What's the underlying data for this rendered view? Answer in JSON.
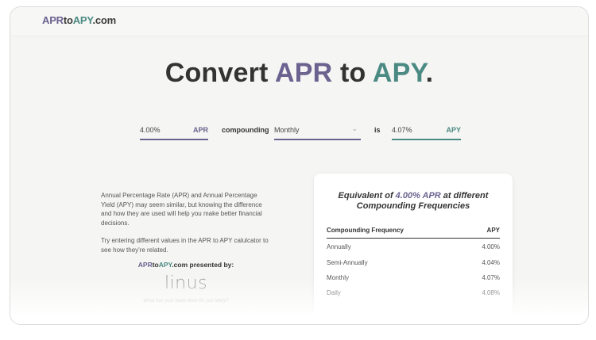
{
  "logo": {
    "apr": "APR",
    "to": "to",
    "apy": "APY",
    "suffix": ".com"
  },
  "hero": {
    "convert": "Convert",
    "apr": "APR",
    "to": "to",
    "apy": "APY",
    "dot": "."
  },
  "calculator": {
    "apr_value": "4.00%",
    "apr_tag": "APR",
    "compounding_label": "compounding",
    "frequency_selected": "Monthly",
    "is_label": "is",
    "apy_value": "4.07%",
    "apy_tag": "APY"
  },
  "intro": {
    "paragraph1": "Annual Percentage Rate (APR) and Annual Percentage Yield (APY) may seem similar, but knowing the difference and how they are used will help you make better financial decisions.",
    "paragraph2": "Try entering different values in the APR to APY calulcator to see how they're related."
  },
  "presented": {
    "apr": "APR",
    "to": "to",
    "apy": "APY",
    "suffix": ".com presented by:"
  },
  "sponsor": {
    "name": "linus",
    "tagline": "What has your bank done for you lately?"
  },
  "table_card": {
    "title_prefix": "Equivalent of ",
    "title_value": "4.00% APR",
    "title_suffix": " at different",
    "title_line2": "Compounding Frequencies",
    "col_frequency": "Compounding Frequency",
    "col_apy": "APY",
    "rows": [
      {
        "frequency": "Annually",
        "apy": "4.00%"
      },
      {
        "frequency": "Semi-Annually",
        "apy": "4.04%"
      },
      {
        "frequency": "Monthly",
        "apy": "4.07%"
      },
      {
        "frequency": "Daily",
        "apy": "4.08%"
      }
    ]
  },
  "colors": {
    "apr": "#6b628f",
    "apy": "#4a8a83",
    "text": "#333333"
  },
  "icons": {
    "dropdown": "chevron-down-icon"
  }
}
